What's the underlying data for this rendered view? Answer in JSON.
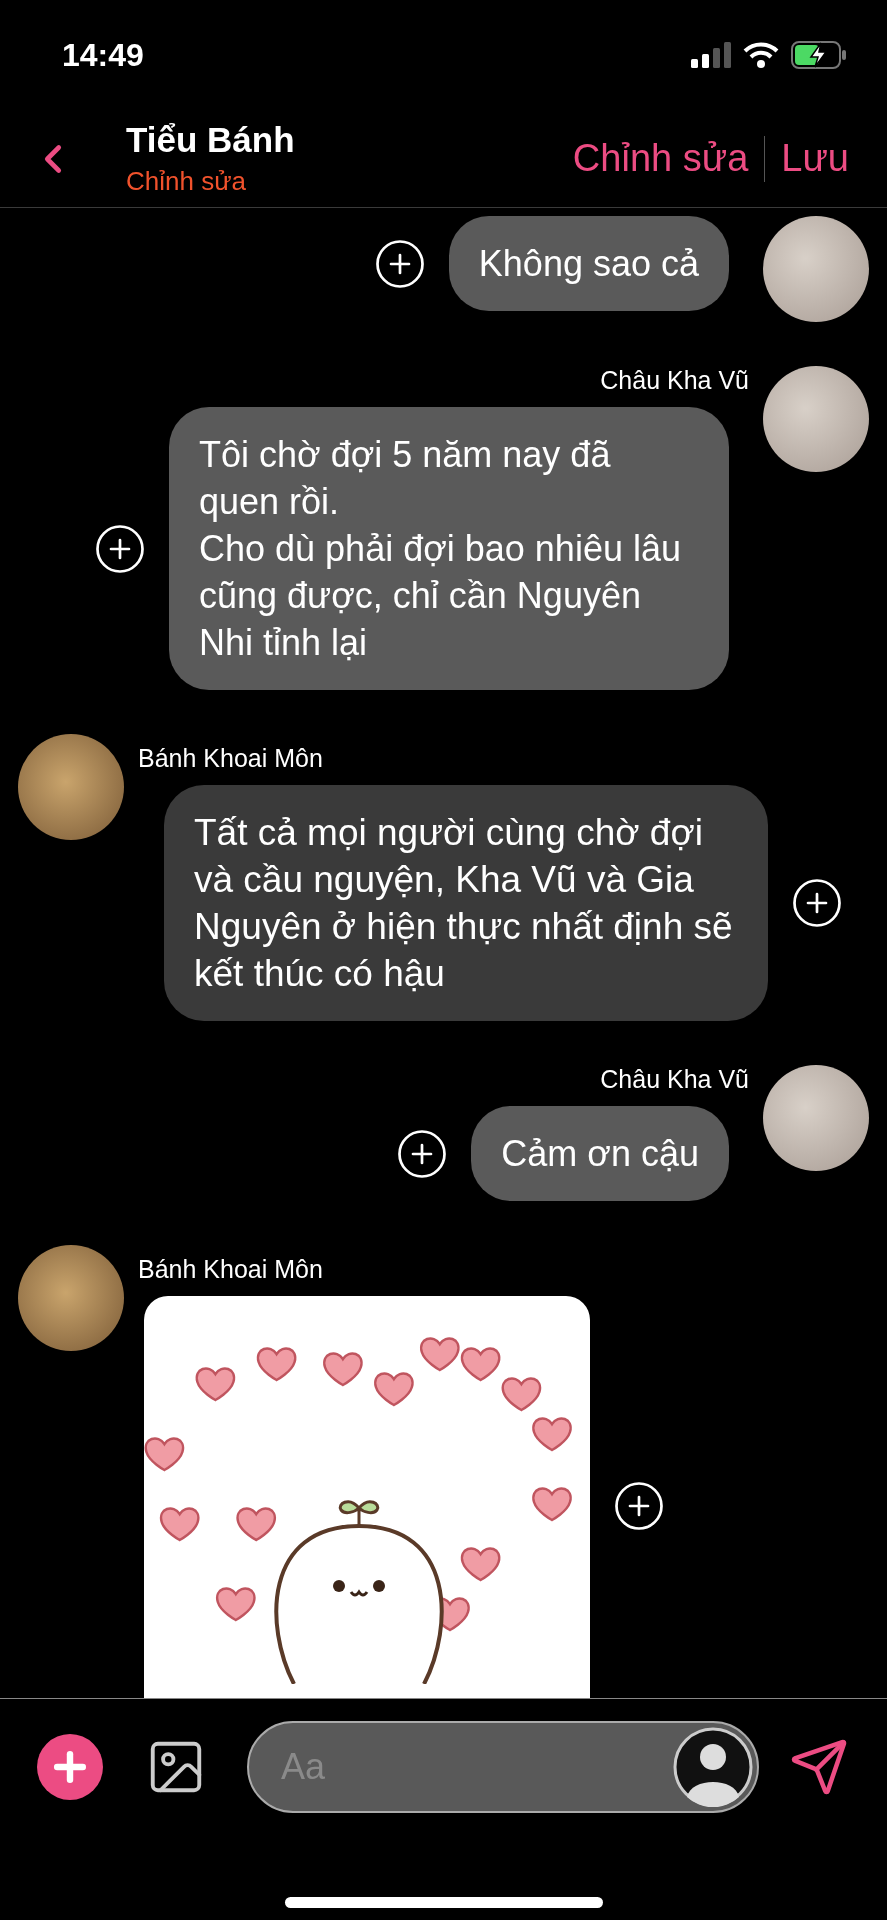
{
  "status_bar": {
    "time": "14:49"
  },
  "header": {
    "title": "Tiểu Bánh",
    "subtitle": "Chỉnh sửa",
    "actions": [
      "Chỉnh sửa",
      "Lưu"
    ]
  },
  "messages": [
    {
      "kind": "text",
      "outgoing": true,
      "text": "Không sao cả"
    },
    {
      "kind": "text",
      "outgoing": true,
      "sender": "Châu Kha Vũ",
      "text": "Tôi chờ đợi 5 năm nay đã quen rồi.\nCho dù phải đợi bao nhiêu lâu cũng được, chỉ cần Nguyên Nhi tỉnh lại"
    },
    {
      "kind": "text",
      "outgoing": false,
      "sender": "Bánh Khoai Môn",
      "text": "Tất cả mọi người cùng chờ đợi và cầu nguyện, Kha Vũ và Gia Nguyên ở hiện thực nhất định sẽ kết thúc có hậu"
    },
    {
      "kind": "text",
      "outgoing": true,
      "sender": "Châu Kha Vũ",
      "text": "Cảm ơn cậu"
    },
    {
      "kind": "image",
      "outgoing": false,
      "sender": "Bánh Khoai Môn"
    }
  ],
  "composer": {
    "placeholder": "Aa"
  }
}
